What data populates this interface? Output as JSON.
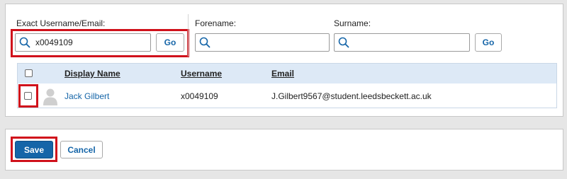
{
  "search": {
    "exact_label": "Exact Username/Email:",
    "exact_value": "x0049109",
    "forename_label": "Forename:",
    "forename_value": "",
    "surname_label": "Surname:",
    "surname_value": "",
    "go_label": "Go"
  },
  "table": {
    "headers": [
      "Display Name",
      "Username",
      "Email"
    ],
    "rows": [
      {
        "display_name": "Jack Gilbert",
        "username": "x0049109",
        "email": "J.Gilbert9567@student.leedsbeckett.ac.uk"
      }
    ]
  },
  "actions": {
    "save_label": "Save",
    "cancel_label": "Cancel"
  },
  "colors": {
    "accent": "#1565a8",
    "highlight": "#d0111b",
    "header_bg": "#dde9f6"
  },
  "icons": {
    "search": "magnifier-icon",
    "avatar": "user-silhouette-icon"
  }
}
